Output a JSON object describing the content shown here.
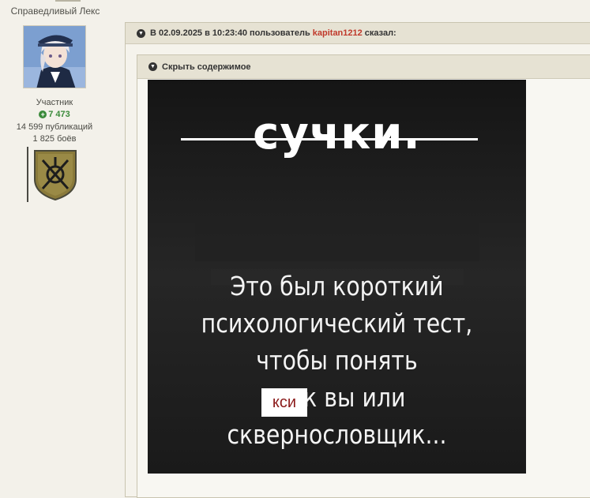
{
  "author": {
    "name": "Справедливый Лекс",
    "role": "Участник",
    "reputation": "7 473",
    "posts": "14 599 публикаций",
    "battles": "1 825 боёв"
  },
  "quote": {
    "prefix": "В 02.09.2025 в 10:23:40 пользователь",
    "user": "kapitan1212",
    "suffix": "сказал:"
  },
  "spoiler": {
    "label": "Скрыть содержимое"
  },
  "meme": {
    "title": "сучки.",
    "lines": [
      "Это был короткий",
      "психологический тест,",
      "чтобы понять",
      "ле      к вы или",
      "сквернословщик..."
    ],
    "overlay": "кси"
  },
  "colors": {
    "page_bg": "#f3f1ea",
    "header_bg": "#e6e2d3",
    "username": "#c0392b",
    "reputation": "#3a8a3a",
    "overlay_text": "#8b1a1a"
  }
}
